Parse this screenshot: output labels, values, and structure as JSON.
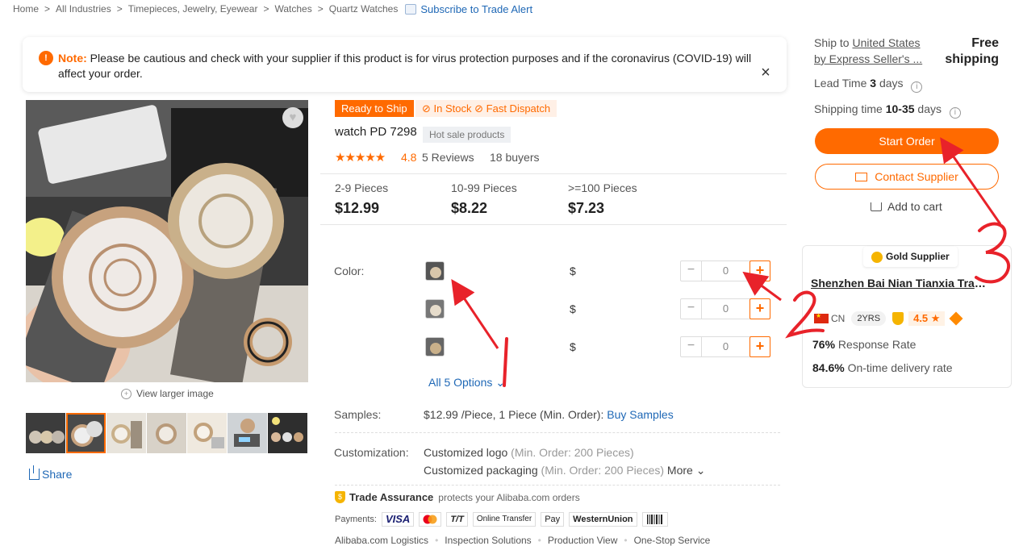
{
  "breadcrumb": {
    "items": [
      "Home",
      "All Industries",
      "Timepieces, Jewelry, Eyewear",
      "Watches",
      "Quartz Watches"
    ],
    "separator": ">",
    "subscribe": "Subscribe to Trade Alert"
  },
  "notice": {
    "label": "Note:",
    "text": "Please be cautious and check with your supplier if this product is for virus protection purposes and if the coronavirus (COVID-19) will affect your order."
  },
  "gallery": {
    "view_larger": "View larger image",
    "thumb_count": 7,
    "active_thumb": 2,
    "share": "Share"
  },
  "product": {
    "tag_ready": "Ready to Ship",
    "tag_stock": "In Stock",
    "tag_dispatch": "Fast Dispatch",
    "title": "watch PD 7298",
    "hot_tag": "Hot sale products",
    "stars": "★★★★★",
    "rating": "4.8",
    "reviews": "5 Reviews",
    "buyers": "18 buyers"
  },
  "tiers": [
    {
      "range": "2-9 Pieces",
      "price": "$12.99"
    },
    {
      "range": "10-99 Pieces",
      "price": "$8.22"
    },
    {
      "range": ">=100 Pieces",
      "price": "$7.23"
    }
  ],
  "colors": {
    "label": "Color:",
    "rows": [
      {
        "currency": "$",
        "qty": "0"
      },
      {
        "currency": "$",
        "qty": "0"
      },
      {
        "currency": "$",
        "qty": "0"
      }
    ],
    "all_options": "All 5 Options"
  },
  "samples": {
    "label": "Samples:",
    "price": "$12.99",
    "unit": "/Piece, 1 Piece (Min. Order):",
    "link": "Buy Samples"
  },
  "customization": {
    "label": "Customization:",
    "items": [
      {
        "name": "Customized logo",
        "min": "(Min. Order: 200 Pieces)"
      },
      {
        "name": "Customized packaging",
        "min": "(Min. Order: 200 Pieces)"
      }
    ],
    "more": "More"
  },
  "trade_assurance": {
    "title": "Trade Assurance",
    "sub": "protects your Alibaba.com orders",
    "payments_label": "Payments:",
    "methods": [
      "VISA",
      "mastercard",
      "T/T",
      "Online Transfer",
      "Pay",
      "WesternUnion",
      "Boleto"
    ]
  },
  "footer_links": [
    "Alibaba.com Logistics",
    "Inspection Solutions",
    "Production View",
    "One-Stop Service"
  ],
  "shipping": {
    "ship_to_prefix": "Ship to",
    "country": "United States",
    "method": "by Express Seller's ...",
    "free_shipping": "Free shipping",
    "lead_label": "Lead Time",
    "lead_value": "3",
    "lead_unit": "days",
    "time_label": "Shipping time",
    "time_value": "10-35",
    "time_unit": "days"
  },
  "actions": {
    "start_order": "Start Order",
    "contact": "Contact Supplier",
    "add_cart": "Add to cart"
  },
  "supplier": {
    "badge": "Gold Supplier",
    "name": "Shenzhen Bai Nian Tianxia Trade ...",
    "country": "CN",
    "years": "2YRS",
    "score": "4.5",
    "response_rate": "76%",
    "response_label": "Response Rate",
    "delivery_rate": "84.6%",
    "delivery_label": "On-time delivery rate"
  },
  "annotations": [
    "1",
    "2",
    "3"
  ],
  "colors_theme": {
    "accent": "#ff6a00",
    "link": "#1f68b6",
    "annotation": "#e8222a"
  }
}
